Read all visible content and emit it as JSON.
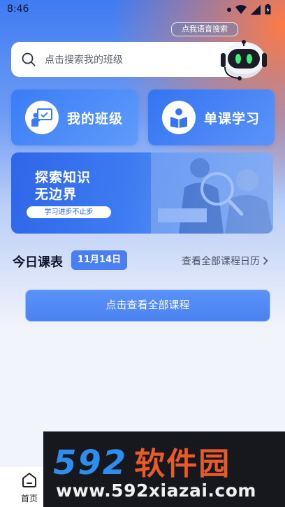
{
  "status_bar": {
    "time": "8:46"
  },
  "voice_search": {
    "label": "点我语音搜索"
  },
  "search": {
    "placeholder": "点击搜索我的班级"
  },
  "cards": [
    {
      "label": "我的班级",
      "icon": "teacher-board-icon"
    },
    {
      "label": "单课学习",
      "icon": "student-reading-icon"
    }
  ],
  "banner": {
    "title_line1": "探索知识",
    "title_line2": "无边界",
    "tag": "学习进步不止步"
  },
  "schedule": {
    "title": "今日课表",
    "date": "11月14日",
    "view_calendar": "查看全部课程日历"
  },
  "all_courses_button": "点击查看全部课程",
  "tabbar": {
    "home_label": "首页"
  },
  "watermark": {
    "brand_number": "592",
    "brand_name": "软件园",
    "url": "www.592xiazai.com"
  },
  "colors": {
    "primary": "#3a7cf6",
    "accent_orange": "#ff7a45",
    "watermark_blue": "#2e8ef0",
    "watermark_orange": "#e85a2a"
  }
}
